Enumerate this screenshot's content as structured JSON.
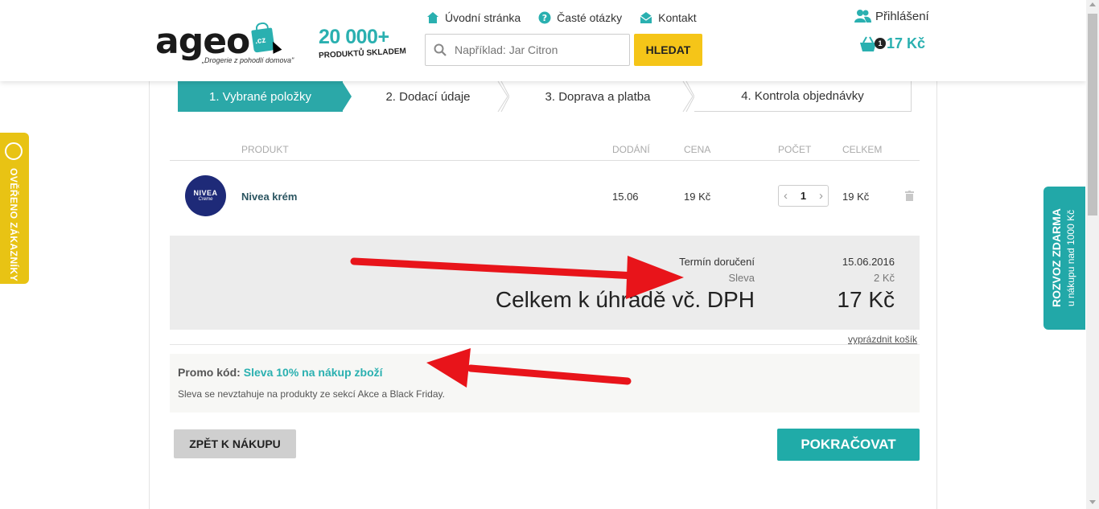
{
  "header": {
    "logo_text": "ageo",
    "logo_badge": ".cz",
    "logo_tagline": "„Drogerie z pohodlí domova\"",
    "products_count": "20 000+",
    "products_label": "PRODUKTŮ SKLADEM",
    "nav": [
      {
        "label": "Úvodní stránka",
        "icon": "home-icon"
      },
      {
        "label": "Časté otázky",
        "icon": "question-icon"
      },
      {
        "label": "Kontakt",
        "icon": "envelope-icon"
      }
    ],
    "search_placeholder": "Například: Jar Citron",
    "search_button": "HLEDAT",
    "login_label": "Přihlášení",
    "cart_count": "1",
    "cart_total": "17 Kč"
  },
  "steps": [
    {
      "label": "1. Vybrané položky",
      "active": true
    },
    {
      "label": "2. Dodací údaje",
      "active": false
    },
    {
      "label": "3. Doprava a platba",
      "active": false
    },
    {
      "label": "4. Kontrola objednávky",
      "active": false
    }
  ],
  "table": {
    "headers": {
      "product": "PRODUKT",
      "delivery": "DODÁNÍ",
      "price": "CENA",
      "qty": "POČET",
      "total": "CELKEM"
    },
    "rows": [
      {
        "image_brand": "NIVEA",
        "image_sub": "Creme",
        "name": "Nivea krém",
        "delivery": "15.06",
        "price": "19 Kč",
        "qty": "1",
        "total": "19 Kč"
      }
    ]
  },
  "summary": {
    "delivery_label": "Termín doručení",
    "delivery_value": "15.06.2016",
    "discount_label": "Sleva",
    "discount_value": "2 Kč",
    "total_label": "Celkem k úhradě vč. DPH",
    "total_value": "17 Kč",
    "empty_cart": "vyprázdnit košík"
  },
  "promo": {
    "label": "Promo kód:",
    "code": "Sleva 10% na nákup zboží",
    "note": "Sleva se nevztahuje na produkty ze sekcí Akce a Black Friday."
  },
  "buttons": {
    "back": "ZPĚT K NÁKUPU",
    "continue": "POKRAČOVAT"
  },
  "side_tabs": {
    "verified": "OVĚŘENO ZÁKAZNÍKY",
    "freeship_title": "ROZVOZ ZDARMA",
    "freeship_sub": "u nákupu nad 1000 Kč"
  },
  "colors": {
    "accent": "#2ab0b0",
    "yellow": "#f5c518",
    "annotation_arrow": "#e8141a"
  }
}
